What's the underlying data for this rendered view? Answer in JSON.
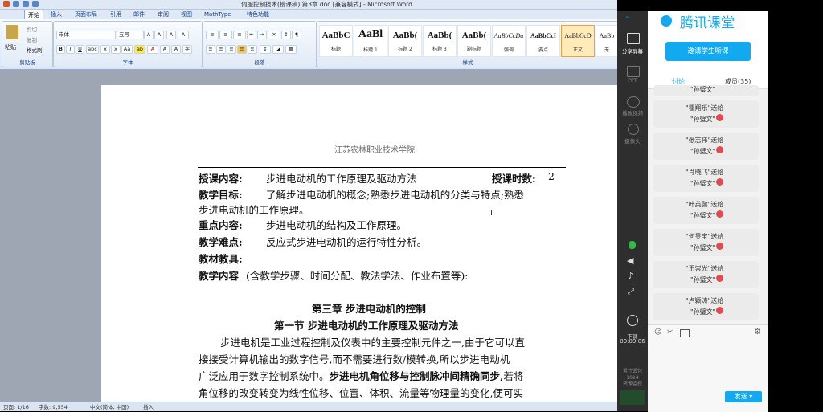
{
  "window": {
    "title": "伺服控制技术(授课稿)  第3章.doc [兼容模式] - Microsoft Word"
  },
  "tabs": [
    "开始",
    "插入",
    "页面布局",
    "引用",
    "邮件",
    "审阅",
    "视图",
    "MathType",
    "特色功能"
  ],
  "ribbon": {
    "clipboard": {
      "paste": "粘贴",
      "cut": "剪切",
      "copy": "复制",
      "format_painter": "格式刷",
      "label": "剪贴板"
    },
    "font": {
      "name": "宋体",
      "size": "五号",
      "label": "字体"
    },
    "paragraph": {
      "label": "段落"
    },
    "styles": {
      "label": "样式",
      "items": [
        {
          "sample": "AaBbC",
          "name": "标题"
        },
        {
          "sample": "AaBl",
          "name": "标题 1"
        },
        {
          "sample": "AaBb(",
          "name": "标题 2"
        },
        {
          "sample": "AaBb(",
          "name": "标题 3"
        },
        {
          "sample": "AaBb(",
          "name": "副标题"
        },
        {
          "sample": "AaBbCcDa",
          "name": "强调"
        },
        {
          "sample": "AaBbCcI",
          "name": "要点"
        },
        {
          "sample": "AaBbCcD",
          "name": "正文"
        },
        {
          "sample": "AaBb",
          "name": "无"
        }
      ]
    }
  },
  "doc": {
    "school": "江苏农林职业技术学院",
    "r1_label": "授课内容:",
    "r1_value": "步进电动机的工作原理及驱动方法",
    "r1_hours_label": "授课时数:",
    "r1_hours": "2",
    "r2_label": "教学目标:",
    "r2_value": "了解步进电动机的概念;熟悉步进电动机的分类与特点;熟悉",
    "r2_cont": "步进电动机的工作原理。",
    "r3_label": "重点内容:",
    "r3_value": "步进电动机的结构及工作原理。",
    "r4_label": "教学难点:",
    "r4_value": "反应式步进电动机的运行特性分析。",
    "r5_label": "教材教具:",
    "r6_label": "教学内容",
    "r6_value": "(含教学步骤、时间分配、教法学法、作业布置等):",
    "chapter": "第三章   步进电动机的控制",
    "section": "第一节  步进电动机的工作原理及驱动方法",
    "p1": "步进电机是工业过程控制及仪表中的主要控制元件之一,由于它可以直",
    "p2": "接接受计算机输出的数字信号,而不需要进行数/模转换,所以步进电动机",
    "p3a": "广泛应用于数字控制系统中。",
    "p3b": "步进电机角位移与控制脉冲间精确同步,",
    "p3c": "若将",
    "p4": "角位移的改变转变为线性位移、位置、体积、流量等物理量的变化,便可实"
  },
  "status": {
    "page": "页面: 1/16",
    "words": "字数: 9,554",
    "lang": "中文(简体, 中国)",
    "mode": "插入",
    "zoom": "100%"
  },
  "classroom": {
    "brand": "腾讯课堂",
    "invite": "邀请学生听课",
    "tab_discuss": "讨论",
    "tab_members": "成员(35)",
    "left": {
      "share": "分享屏幕",
      "ppt": "PPT",
      "video": "播放视频",
      "camera": "摄像头",
      "exit": "下课"
    },
    "timer": "00:09:06",
    "stats": "累计丢包\n1024\n资源监控",
    "send": "发送",
    "gifts": [
      {
        "from": "\"瞿翔乐\"送给",
        "to": "\"孙璧文\""
      },
      {
        "from": "\"张志伟\"送给",
        "to": "\"孙璧文\""
      },
      {
        "from": "\"肖晓飞\"送给",
        "to": "\"孙璧文\""
      },
      {
        "from": "\"叶英健\"送给",
        "to": "\"孙璧文\""
      },
      {
        "from": "\"何昱宝\"送给",
        "to": "\"孙璧文\""
      },
      {
        "from": "\"王崇光\"送给",
        "to": "\"孙璧文\""
      },
      {
        "from": "\"卢颖涛\"送给",
        "to": "\"孙璧文\""
      }
    ],
    "partial_top": "\"孙璧文\""
  },
  "colors": {
    "accent": "#12a9f0",
    "ribbon": "#dfe8f5",
    "panel_dark": "#2e2e2e"
  }
}
